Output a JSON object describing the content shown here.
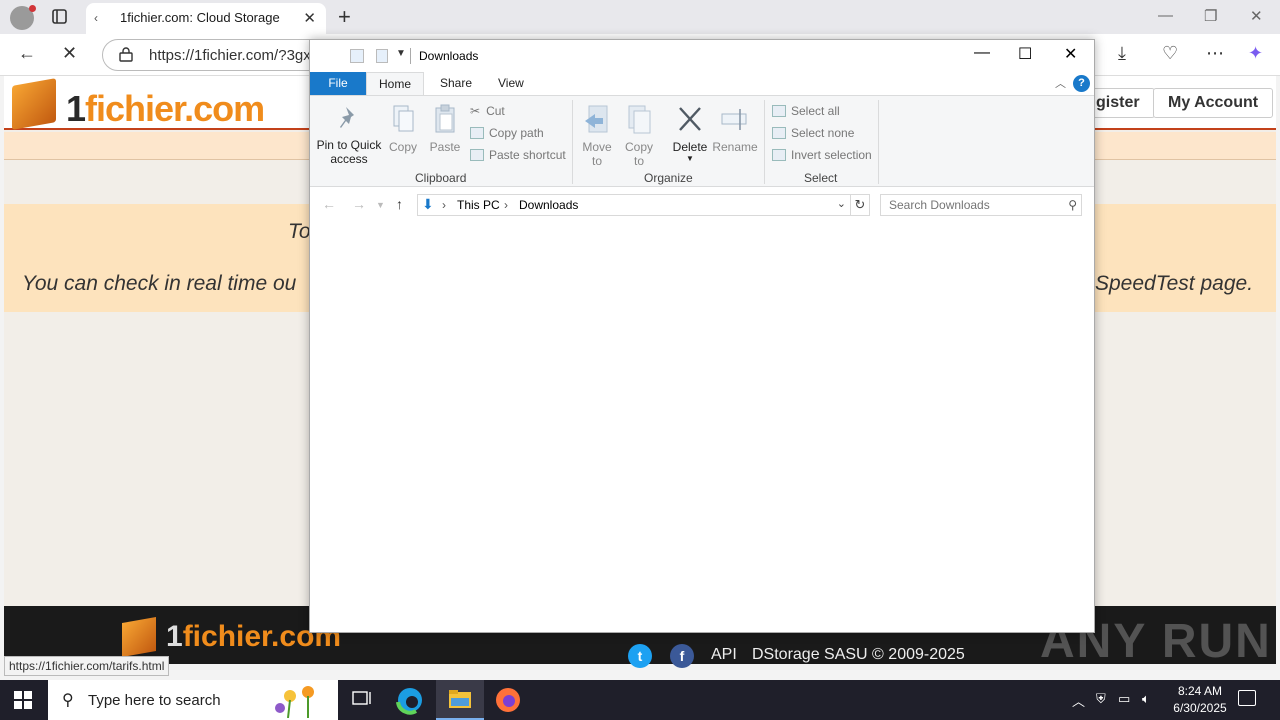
{
  "browser": {
    "tab_title": "1fichier.com: Cloud Storage",
    "url": "https://1fichier.com/?3gxk"
  },
  "site": {
    "logo_text_a": "1",
    "logo_text_b": "fichier.com",
    "nav_register": "gister",
    "nav_account": "My Account",
    "notice_line1": "To",
    "notice_line2a": "You can check in real time ou",
    "notice_line2b": "SpeedTest page.",
    "footer_api": "API",
    "footer_copy": "DStorage SASU © 2009-2025",
    "status_url": "https://1fichier.com/tarifs.html",
    "watermark": "ANY RUN"
  },
  "explorer": {
    "window_title": "Downloads",
    "ribbon_tabs": {
      "file": "File",
      "home": "Home",
      "share": "Share",
      "view": "View"
    },
    "clipboard": {
      "pin_line1": "Pin to Quick",
      "pin_line2": "access",
      "copy": "Copy",
      "paste": "Paste",
      "cut": "Cut",
      "copy_path": "Copy path",
      "paste_shortcut": "Paste shortcut",
      "label": "Clipboard"
    },
    "organize": {
      "move_to_a": "Move",
      "move_to_b": "to",
      "copy_to_a": "Copy",
      "copy_to_b": "to",
      "delete": "Delete",
      "rename": "Rename",
      "label": "Organize"
    },
    "select": {
      "select_all": "Select all",
      "select_none": "Select none",
      "invert": "Invert selection",
      "label": "Select"
    },
    "path": {
      "this_pc": "This PC",
      "downloads": "Downloads"
    },
    "search_placeholder": "Search Downloads"
  },
  "taskbar": {
    "search_placeholder": "Type here to search",
    "time": "8:24 AM",
    "date": "6/30/2025"
  }
}
